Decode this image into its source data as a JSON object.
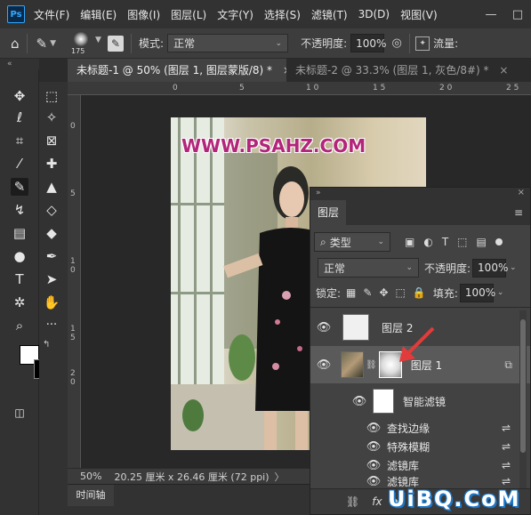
{
  "app": {
    "logo": "Ps"
  },
  "menu": [
    "文件(F)",
    "编辑(E)",
    "图像(I)",
    "图层(L)",
    "文字(Y)",
    "选择(S)",
    "滤镜(T)",
    "3D(D)",
    "视图(V)"
  ],
  "window_controls": {
    "minimize": "—",
    "maximize": "□"
  },
  "options_bar": {
    "brush_size": "175",
    "mode_label": "模式:",
    "mode_value": "正常",
    "opacity_label": "不透明度:",
    "opacity_value": "100%",
    "flow_label": "流量:"
  },
  "collapse_glyph": "«",
  "tabs": [
    {
      "label": "未标题-1 @ 50% (图层 1, 图层蒙版/8) *",
      "close": "×",
      "active": true
    },
    {
      "label": "未标题-2 @ 33.3% (图层 1, 灰色/8#) *",
      "close": "×",
      "active": false
    }
  ],
  "rulers": {
    "top": [
      "0",
      "5",
      "1 0",
      "1 5",
      "2 0",
      "2 5"
    ],
    "left": [
      "0",
      "5",
      "1 0",
      "1 5",
      "2 0"
    ]
  },
  "canvas": {
    "watermark": "WWW.PSAHZ.COM"
  },
  "status": {
    "zoom": "50%",
    "doc_size": "20.25 厘米 x 26.46 厘米 (72 ppi)",
    "arrow": "〉"
  },
  "timeline": {
    "label": "时间轴"
  },
  "layers_panel": {
    "title": "图层",
    "filter_label": "类型",
    "blend_mode": "正常",
    "opacity_label": "不透明度:",
    "opacity_value": "100%",
    "lock_label": "锁定:",
    "fill_label": "填充:",
    "fill_value": "100%",
    "layers": [
      {
        "name": "图层 2"
      },
      {
        "name": "图层 1"
      }
    ],
    "smart_filters_label": "智能滤镜",
    "filters": [
      {
        "name": "查找边缘"
      },
      {
        "name": "特殊模糊"
      },
      {
        "name": "滤镜库"
      },
      {
        "name": "滤镜库"
      }
    ],
    "footer_fx": "fx"
  },
  "site_watermark": "UiBQ.CoM",
  "colors": {
    "accent": "#31a8ff",
    "panel_bg": "#424242",
    "watermark_pink": "#b3257a",
    "arrow_red": "#e23b3b"
  }
}
